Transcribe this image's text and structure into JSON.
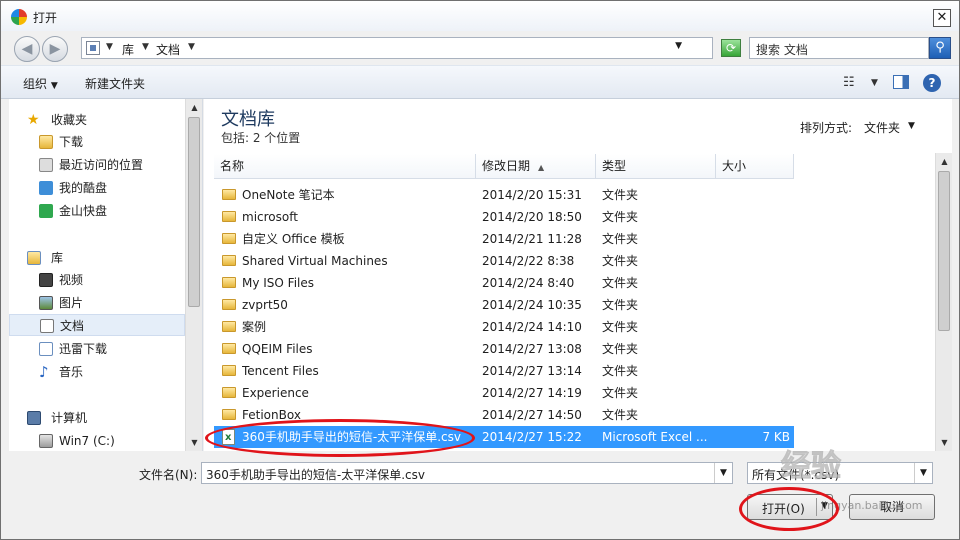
{
  "window": {
    "title": "打开",
    "close_label": "✕"
  },
  "address": {
    "crumbs": [
      "库",
      "文档"
    ],
    "search_placeholder": "搜索 文档"
  },
  "toolbar": {
    "organize": "组织",
    "new_folder": "新建文件夹"
  },
  "nav": {
    "favorites": "收藏夹",
    "fav_items": [
      "下载",
      "最近访问的位置",
      "我的酷盘",
      "金山快盘"
    ],
    "libraries": "库",
    "lib_items": [
      "视频",
      "图片",
      "文档",
      "迅雷下载",
      "音乐"
    ],
    "computer": "计算机",
    "computer_items": [
      "Win7 (C:)"
    ]
  },
  "content": {
    "title": "文档库",
    "subtitle": "包括: 2 个位置",
    "sort_label": "排列方式:",
    "sort_value": "文件夹"
  },
  "columns": [
    "名称",
    "修改日期",
    "类型",
    "大小"
  ],
  "files": [
    {
      "name": "OneNote 笔记本",
      "date": "2014/2/20 15:31",
      "type": "文件夹",
      "size": ""
    },
    {
      "name": "microsoft",
      "date": "2014/2/20 18:50",
      "type": "文件夹",
      "size": ""
    },
    {
      "name": "自定义 Office 模板",
      "date": "2014/2/21 11:28",
      "type": "文件夹",
      "size": ""
    },
    {
      "name": "Shared Virtual Machines",
      "date": "2014/2/22 8:38",
      "type": "文件夹",
      "size": ""
    },
    {
      "name": "My ISO Files",
      "date": "2014/2/24 8:40",
      "type": "文件夹",
      "size": ""
    },
    {
      "name": "zvprt50",
      "date": "2014/2/24 10:35",
      "type": "文件夹",
      "size": ""
    },
    {
      "name": "案例",
      "date": "2014/2/24 14:10",
      "type": "文件夹",
      "size": ""
    },
    {
      "name": "QQEIM Files",
      "date": "2014/2/27 13:08",
      "type": "文件夹",
      "size": ""
    },
    {
      "name": "Tencent Files",
      "date": "2014/2/27 13:14",
      "type": "文件夹",
      "size": ""
    },
    {
      "name": "Experience",
      "date": "2014/2/27 14:19",
      "type": "文件夹",
      "size": ""
    },
    {
      "name": "FetionBox",
      "date": "2014/2/27 14:50",
      "type": "文件夹",
      "size": ""
    },
    {
      "name": "360手机助手导出的短信-太平洋保单.csv",
      "date": "2014/2/27 15:22",
      "type": "Microsoft Excel ...",
      "size": "7 KB"
    }
  ],
  "footer": {
    "filename_label": "文件名(N):",
    "filename_value": "360手机助手导出的短信-太平洋保单.csv",
    "filter_value": "所有文件(*.csv)",
    "open_label": "打开(O)",
    "cancel_label": "取消"
  },
  "watermark": {
    "main": "经验",
    "sub": "jingyan.baidu.com"
  }
}
